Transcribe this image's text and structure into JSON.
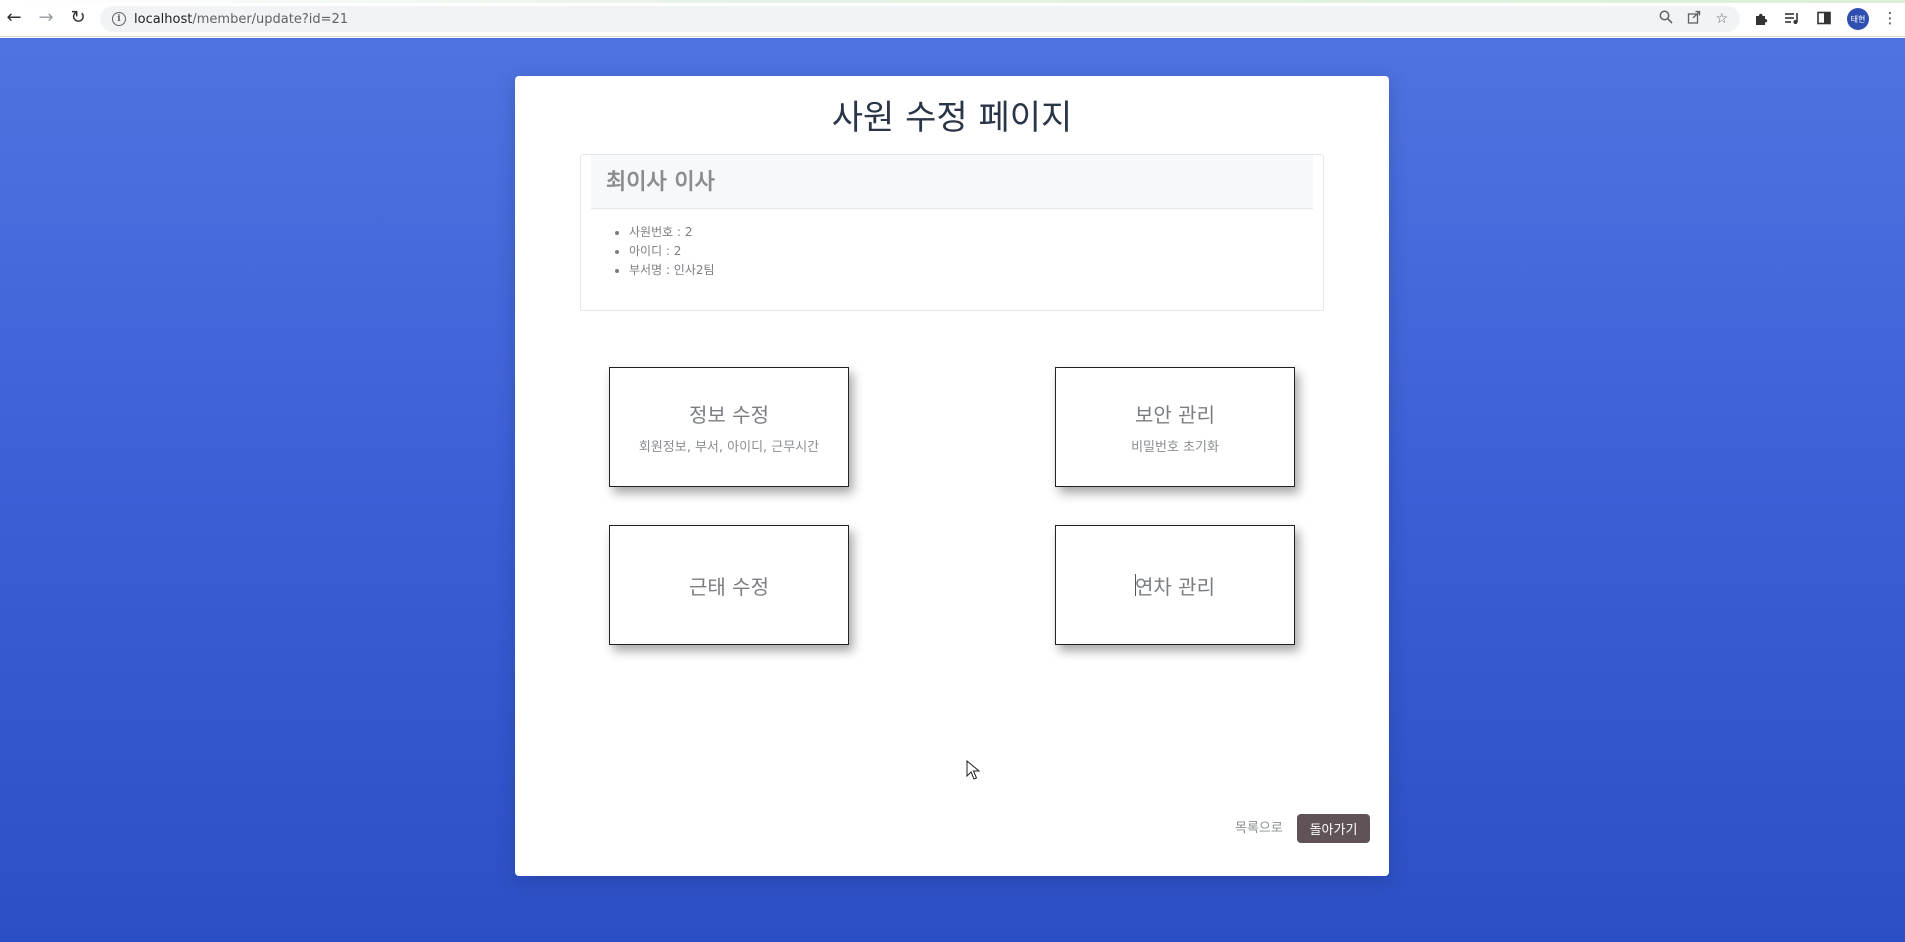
{
  "browser": {
    "url_host": "localhost",
    "url_path": "/member/update?id=21",
    "avatar_text": "태현",
    "icons": {
      "back": "arrow-left-icon",
      "forward": "arrow-right-icon",
      "reload": "reload-icon",
      "site_info": "info-icon",
      "zoom": "zoom-icon",
      "share": "share-icon",
      "bookmark": "star-icon",
      "extensions": "puzzle-icon",
      "media": "playlist-icon",
      "sidepanel": "side-panel-icon",
      "menu": "kebab-menu-icon"
    }
  },
  "page": {
    "title": "사원 수정 페이지",
    "background_colors": [
      "#4f74e0",
      "#2c4fc4"
    ]
  },
  "member": {
    "name_title": "최이사 이사",
    "details": [
      "사원번호 : 2",
      "아이디 : 2",
      "부서명 : 인사2팀"
    ]
  },
  "tiles": [
    {
      "title": "정보 수정",
      "subtitle": "회원정보, 부서, 아이디, 근무시간"
    },
    {
      "title": "보안 관리",
      "subtitle": "비밀번호 초기화"
    },
    {
      "title": "근태 수정",
      "subtitle": ""
    },
    {
      "title": "연차 관리",
      "subtitle": ""
    }
  ],
  "actions": {
    "list_label": "목록으로",
    "back_label": "돌아가기",
    "back_color": "#5f5358"
  }
}
